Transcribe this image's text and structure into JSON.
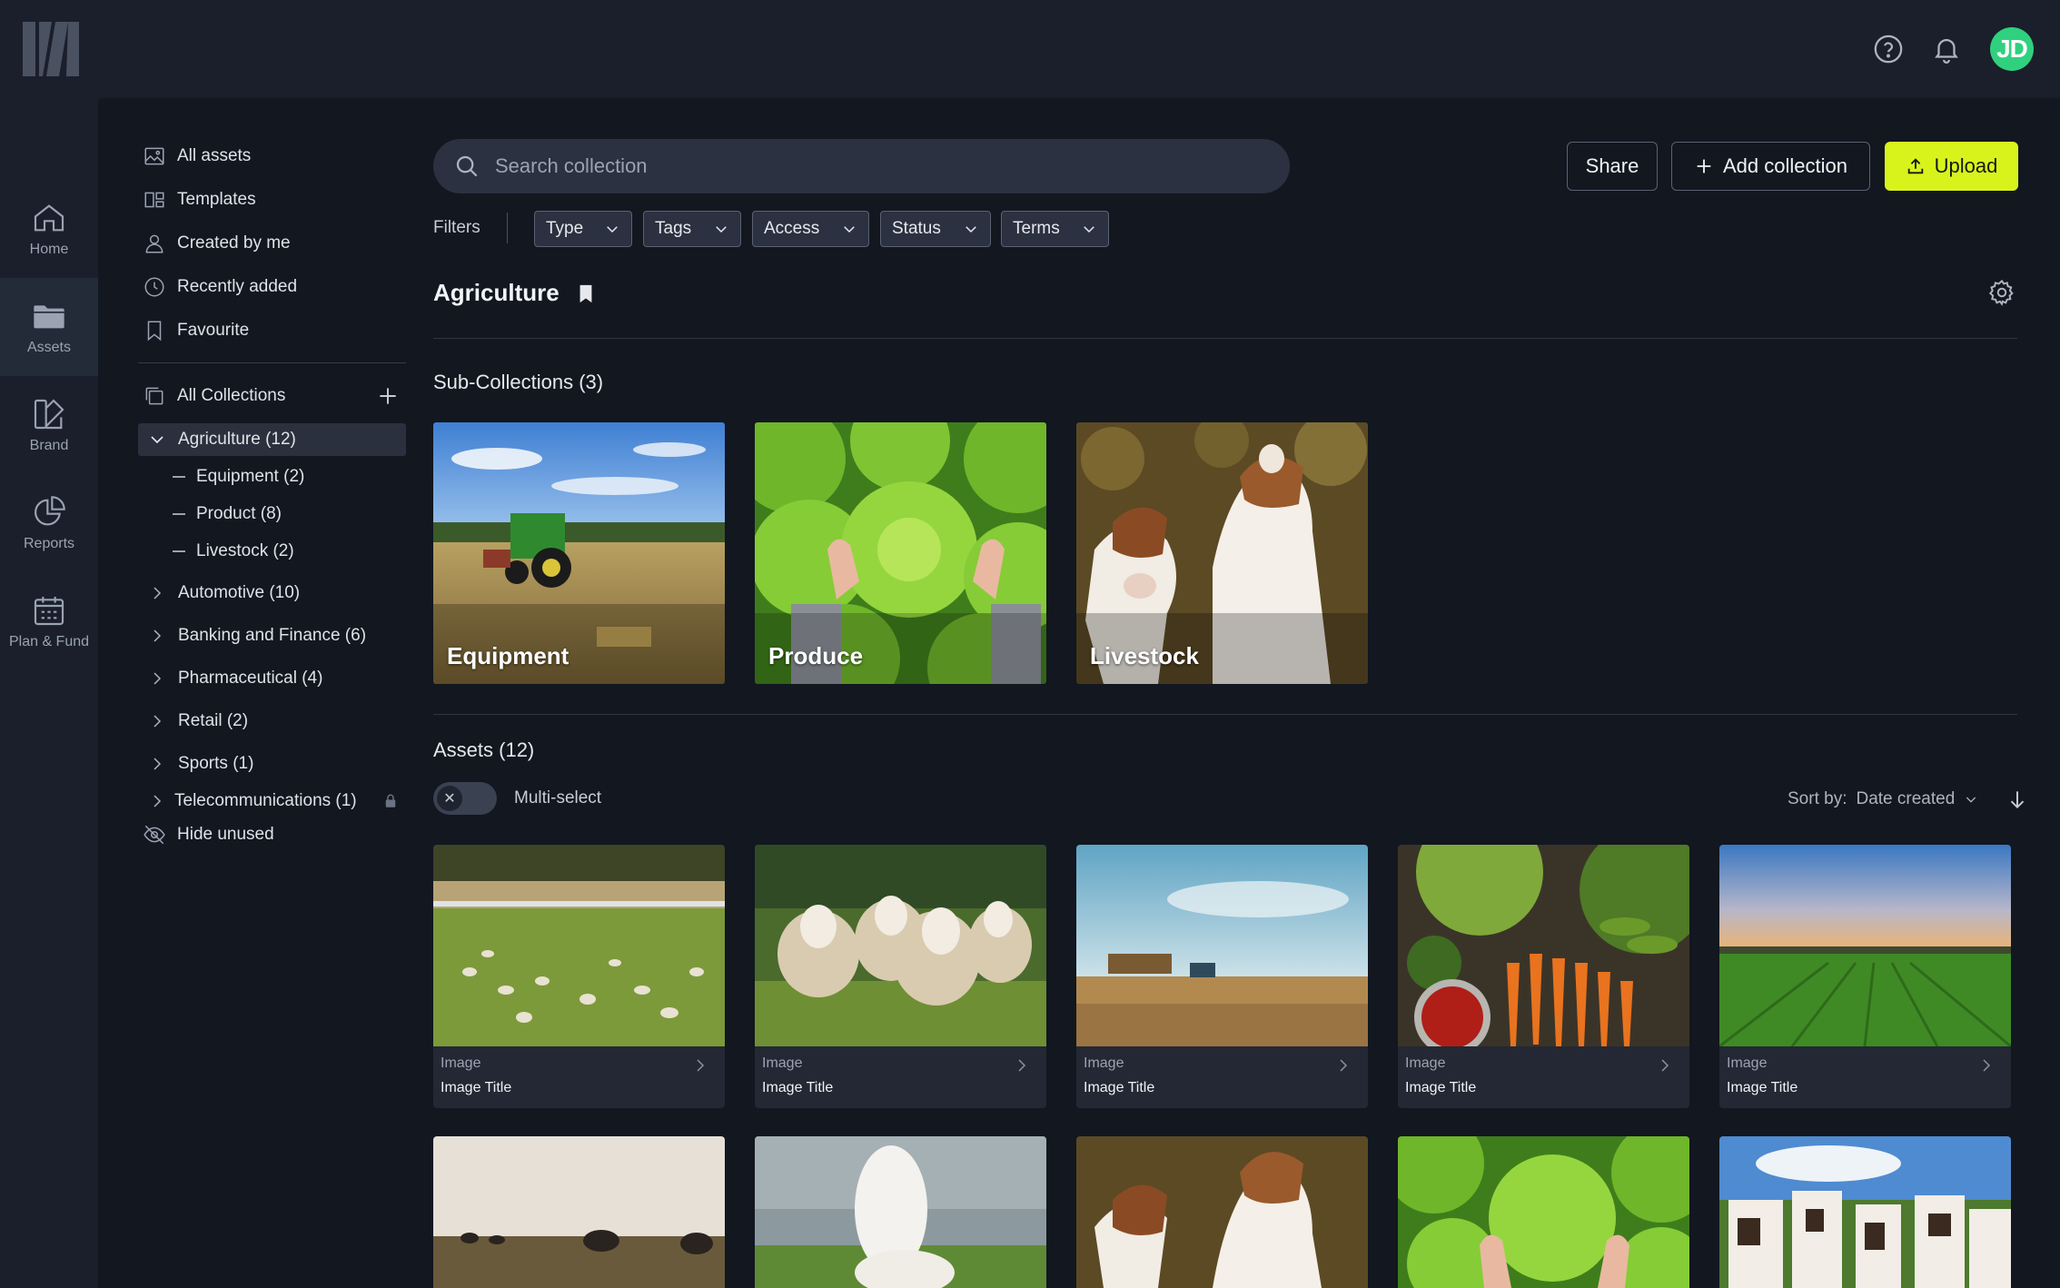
{
  "header": {
    "help_icon": "help-circle-icon",
    "notifications_icon": "bell-icon",
    "avatar_initials": "JD",
    "avatar_color": "#2fd17e"
  },
  "rail": {
    "items": [
      {
        "label": "Home",
        "icon": "home-icon"
      },
      {
        "label": "Assets",
        "icon": "folder-icon",
        "active": true
      },
      {
        "label": "Brand",
        "icon": "brand-icon"
      },
      {
        "label": "Reports",
        "icon": "pie-chart-icon"
      },
      {
        "label": "Plan & Fund",
        "icon": "calendar-icon"
      }
    ]
  },
  "sidebar": {
    "links": [
      {
        "label": "All assets",
        "icon": "image-icon"
      },
      {
        "label": "Templates",
        "icon": "templates-icon"
      },
      {
        "label": "Created by me",
        "icon": "user-icon"
      },
      {
        "label": "Recently added",
        "icon": "clock-icon"
      },
      {
        "label": "Favourite",
        "icon": "bookmark-icon"
      }
    ],
    "all_collections": "All Collections",
    "collections": [
      {
        "label": "Agriculture (12)",
        "expanded": true,
        "selected": true,
        "children": [
          "Equipment (2)",
          "Product (8)",
          "Livestock (2)"
        ]
      },
      {
        "label": "Automotive (10)"
      },
      {
        "label": "Banking and Finance (6)"
      },
      {
        "label": "Pharmaceutical (4)"
      },
      {
        "label": "Retail (2)"
      },
      {
        "label": "Sports (1)"
      },
      {
        "label": "Telecommunications (1)",
        "locked": true
      }
    ],
    "hide_unused": "Hide unused"
  },
  "search": {
    "placeholder": "Search collection"
  },
  "actions": {
    "share": "Share",
    "add_collection": "Add collection",
    "upload": "Upload",
    "upload_color": "#d8f31c"
  },
  "filters": {
    "label": "Filters",
    "items": [
      "Type",
      "Tags",
      "Access",
      "Status",
      "Terms"
    ]
  },
  "collection": {
    "title": "Agriculture"
  },
  "subcollections": {
    "title": "Sub-Collections (3)",
    "items": [
      "Equipment",
      "Produce",
      "Livestock"
    ]
  },
  "assets": {
    "title": "Assets (12)",
    "multiselect_label": "Multi-select",
    "sort_label": "Sort by:",
    "sort_value": "Date created",
    "items": [
      {
        "type": "Image",
        "title": "Image Title"
      },
      {
        "type": "Image",
        "title": "Image Title"
      },
      {
        "type": "Image",
        "title": "Image Title"
      },
      {
        "type": "Image",
        "title": "Image Title"
      },
      {
        "type": "Image",
        "title": "Image Title"
      }
    ]
  }
}
